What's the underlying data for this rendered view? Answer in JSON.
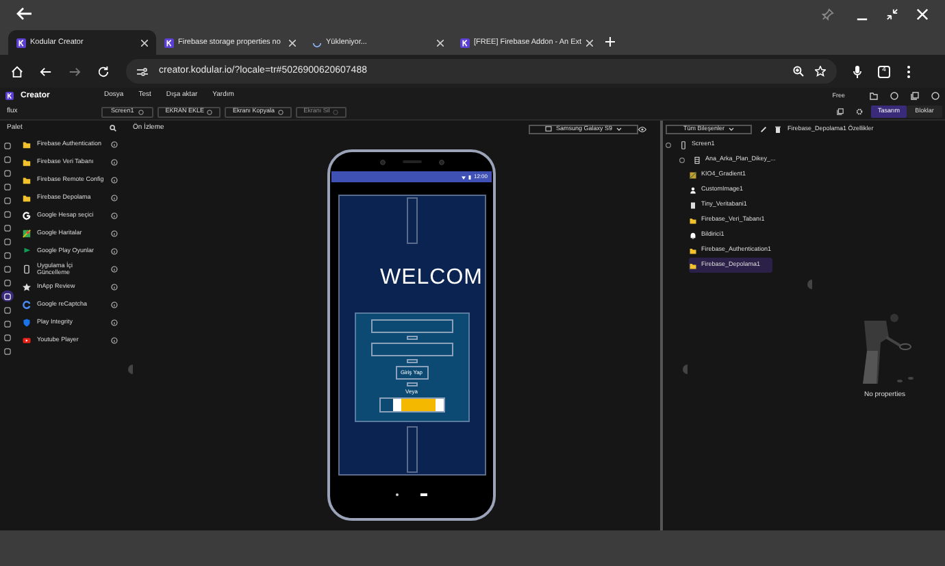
{
  "tabs": [
    {
      "title": "Kodular Creator",
      "selected": true,
      "kind": "kodular"
    },
    {
      "title": "Firebase storage properties no",
      "selected": false,
      "kind": "kodular"
    },
    {
      "title": "Yükleniyor...",
      "selected": false,
      "kind": "loading"
    },
    {
      "title": "[FREE] Firebase Addon - An Ext",
      "selected": false,
      "kind": "kodular"
    }
  ],
  "address_bar": {
    "url": "creator.kodular.io/?locale=tr#5026900620607488",
    "tab_count": "4"
  },
  "app": {
    "title": "Creator",
    "menu": [
      "Dosya",
      "Test",
      "Dışa aktar",
      "Yardım"
    ],
    "plan": "Free"
  },
  "toolbar": {
    "project": "flux",
    "screen": "Screen1",
    "buttons": [
      {
        "label": "EKRAN EKLE",
        "disabled": false
      },
      {
        "label": "Ekranı Kopyala",
        "disabled": false
      },
      {
        "label": "Ekranı Sil",
        "disabled": true
      }
    ],
    "views": [
      {
        "label": "Tasarım",
        "selected": true
      },
      {
        "label": "Bloklar",
        "selected": false
      }
    ]
  },
  "palette": {
    "title": "Palet",
    "categories": [
      {
        "selected": false
      },
      {
        "selected": false
      },
      {
        "selected": false
      },
      {
        "selected": false
      },
      {
        "selected": false
      },
      {
        "selected": false
      },
      {
        "selected": false
      },
      {
        "selected": false
      },
      {
        "selected": false
      },
      {
        "selected": false
      },
      {
        "selected": false
      },
      {
        "selected": true
      },
      {
        "selected": false
      },
      {
        "selected": false
      },
      {
        "selected": false
      },
      {
        "selected": false
      }
    ],
    "items": [
      {
        "name": "Firebase Authentication",
        "kind": "folder"
      },
      {
        "name": "Firebase Veri Tabanı",
        "kind": "folder"
      },
      {
        "name": "Firebase Remote Config",
        "kind": "folder"
      },
      {
        "name": "Firebase Depolama",
        "kind": "folder"
      },
      {
        "name": "Google Hesap seçici",
        "kind": "google"
      },
      {
        "name": "Google Haritalar",
        "kind": "maps"
      },
      {
        "name": "Google Play Oyunlar",
        "kind": "play"
      },
      {
        "name": "Uygulama İçi Güncelleme",
        "kind": "phone"
      },
      {
        "name": "InApp Review",
        "kind": "star"
      },
      {
        "name": "Google reCaptcha",
        "kind": "captcha"
      },
      {
        "name": "Play Integrity",
        "kind": "shield"
      },
      {
        "name": "Youtube Player",
        "kind": "youtube"
      }
    ]
  },
  "preview": {
    "title": "Ön İzleme",
    "device": "Samsung Galaxy S9",
    "phone": {
      "time": "12:00",
      "heading": "WELCOM",
      "button": "Giriş Yap",
      "separator": "Veya"
    }
  },
  "components": {
    "filter": "Tüm Bileşenler",
    "tree": [
      {
        "name": "Screen1",
        "kind": "screen",
        "toggle": true,
        "selected": false,
        "children": [
          {
            "name": "Ana_Arka_Plan_Dikey_...",
            "kind": "arrangement",
            "toggle": true,
            "selected": false
          },
          {
            "name": "KIO4_Gradient1",
            "kind": "gradient",
            "toggle": false,
            "selected": false
          },
          {
            "name": "CustomImage1",
            "kind": "person",
            "toggle": false,
            "selected": false
          },
          {
            "name": "Tiny_Veritabani1",
            "kind": "db",
            "toggle": false,
            "selected": false
          },
          {
            "name": "Firebase_Veri_Tabanı1",
            "kind": "folder",
            "toggle": false,
            "selected": false
          },
          {
            "name": "Bildirici1",
            "kind": "bell",
            "toggle": false,
            "selected": false
          },
          {
            "name": "Firebase_Authentication1",
            "kind": "folder",
            "toggle": false,
            "selected": false
          },
          {
            "name": "Firebase_Depolama1",
            "kind": "folder",
            "toggle": false,
            "selected": true
          }
        ]
      }
    ]
  },
  "properties": {
    "title": "Firebase_Depolama1 Özellikler",
    "empty_text": "No properties"
  }
}
